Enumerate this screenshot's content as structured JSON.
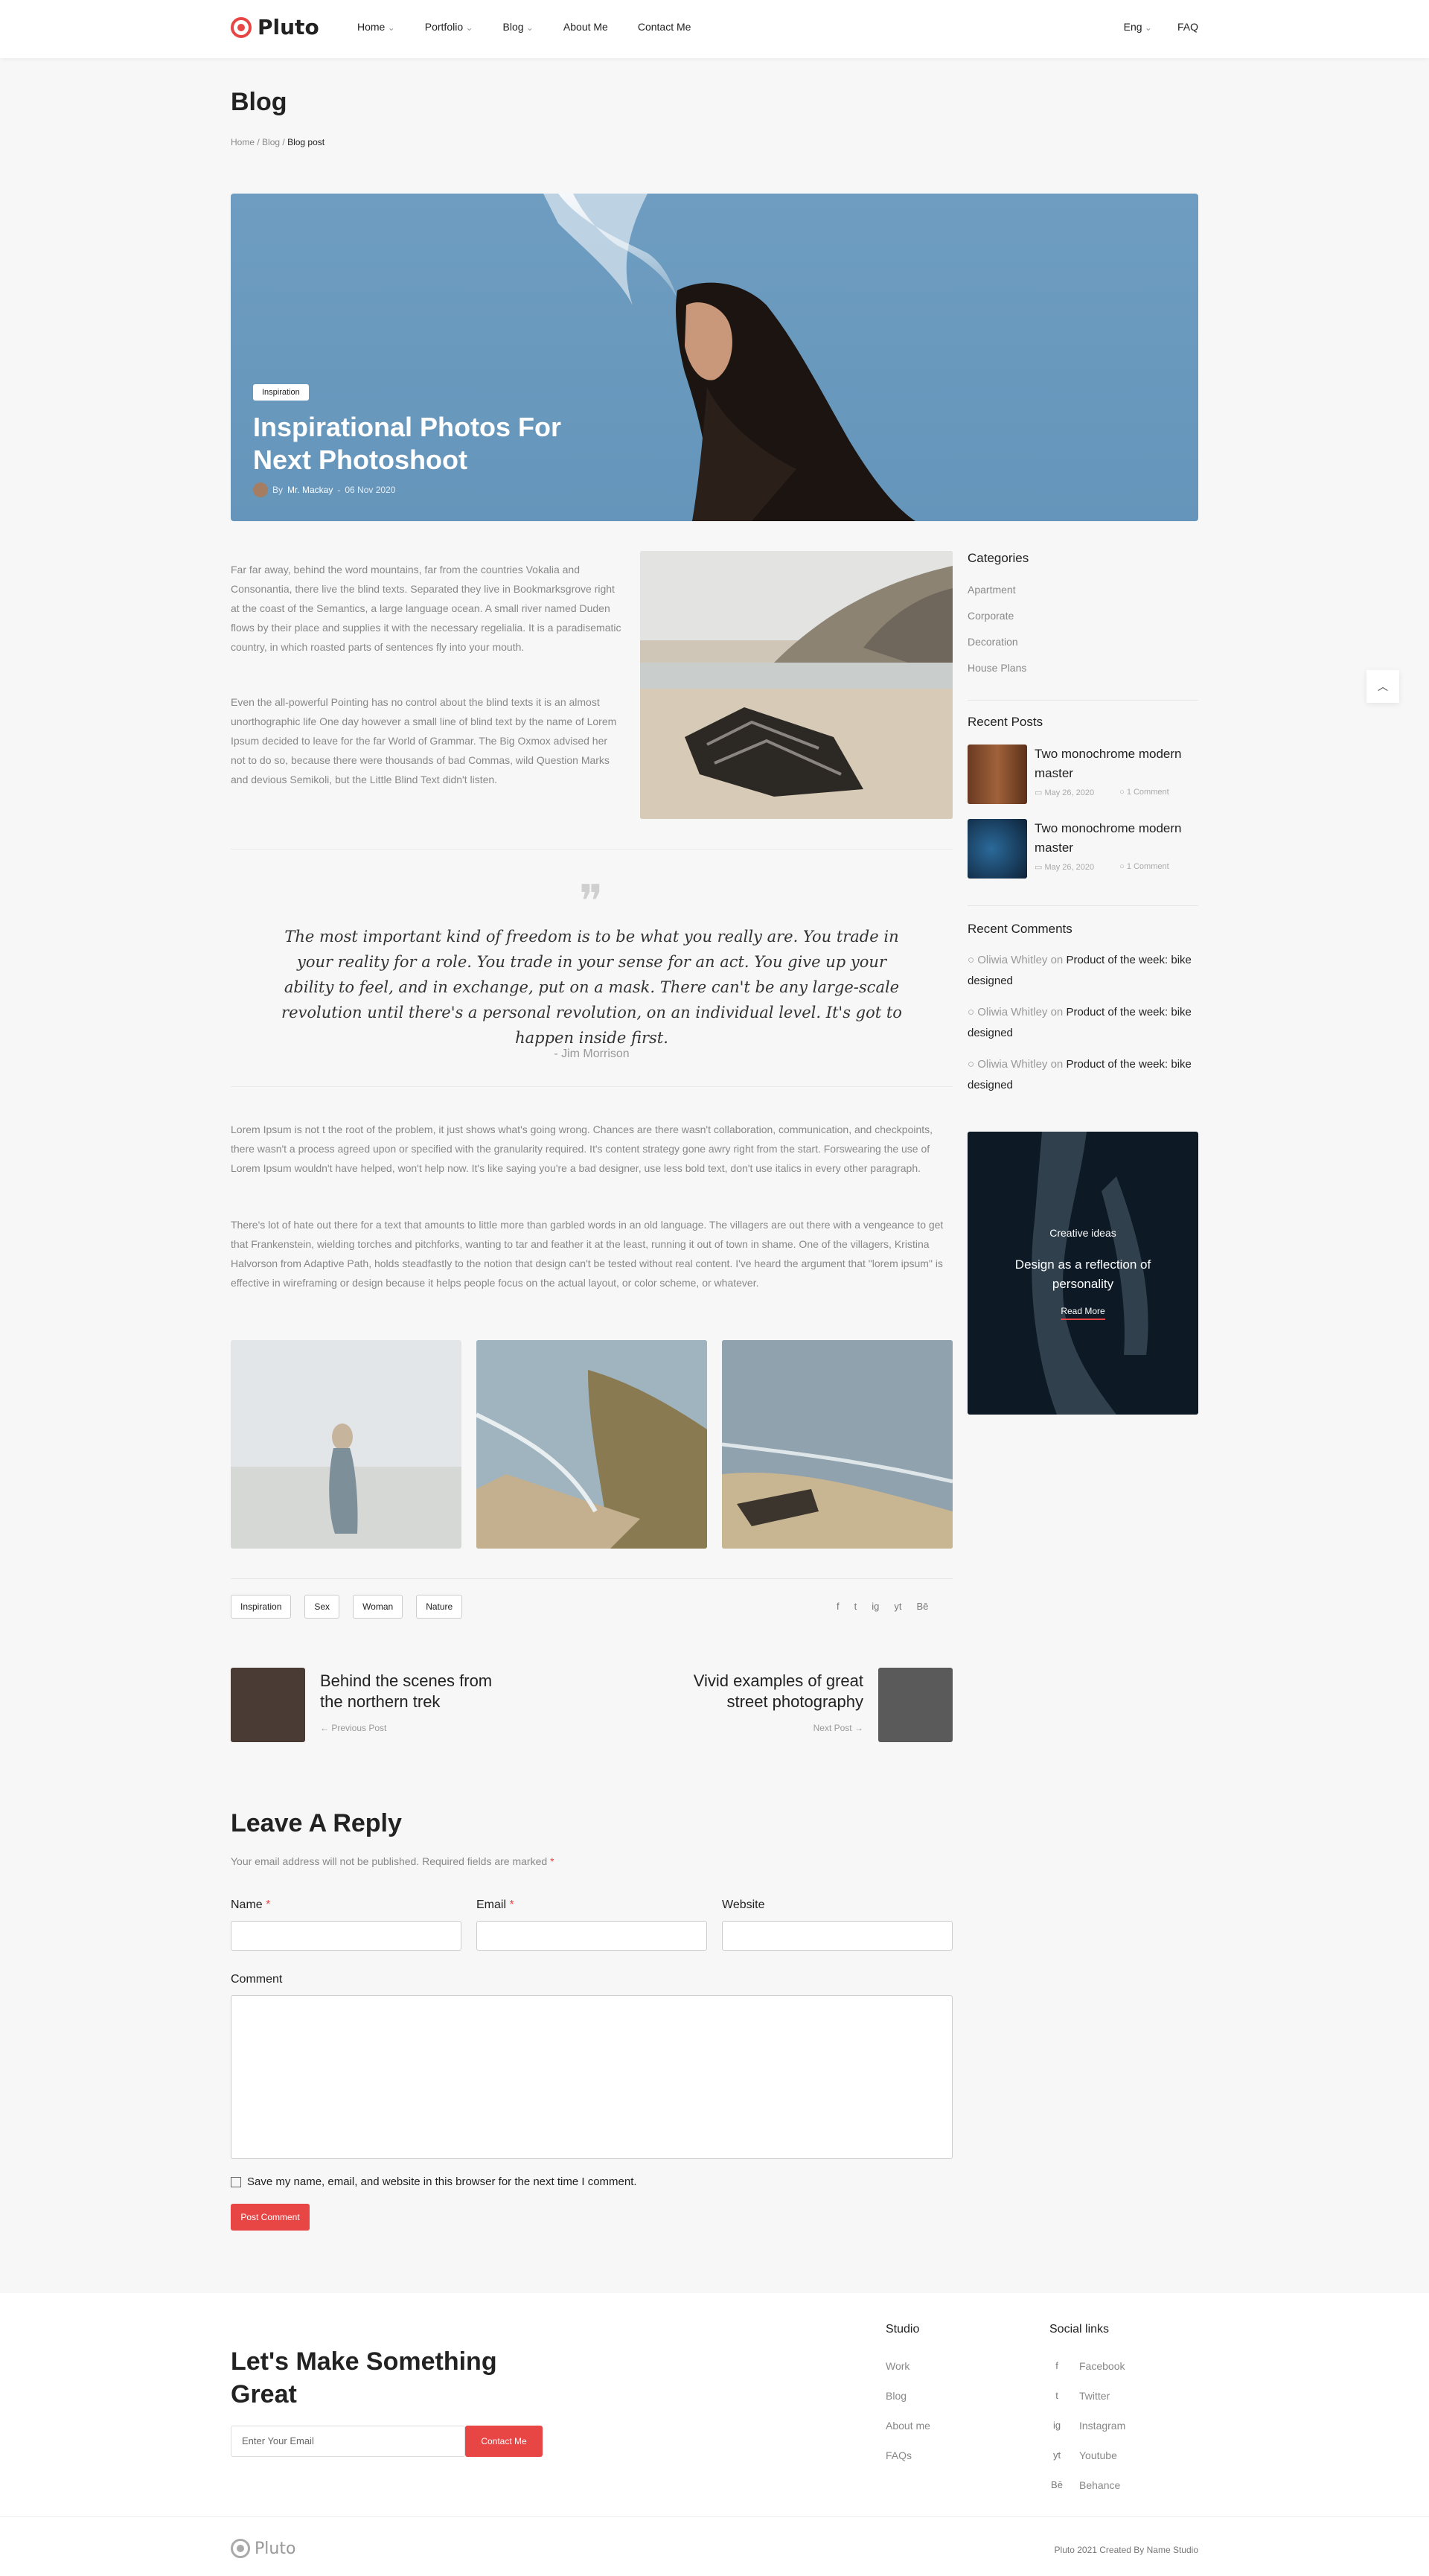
{
  "brand": {
    "name": "Pluto",
    "accent": "#e84545"
  },
  "nav": {
    "items": [
      "Home",
      "Portfolio",
      "Blog",
      "About Me",
      "Contact Me"
    ],
    "lang": "Eng",
    "faq": "FAQ"
  },
  "page": {
    "title": "Blog",
    "crumb_home": "Home",
    "crumb_blog": "Blog",
    "crumb_current": "Blog post"
  },
  "hero": {
    "tag": "Inspiration",
    "title": "Inspirational Photos For Next Photoshoot",
    "by": "By",
    "author": "Mr. Mackay",
    "date": "06 Nov 2020"
  },
  "article": {
    "p1": "Far far away, behind the word mountains, far from the countries Vokalia and Consonantia, there live the blind texts. Separated they live in Bookmarksgrove right at the coast of the Semantics, a large language ocean. A small river named Duden flows by their place and supplies it with the necessary regelialia. It is a paradisematic country, in which roasted parts of sentences fly into your mouth.",
    "p2": "Even the all-powerful Pointing has no control about the blind texts it is an almost unorthographic life One day however a small line of blind text by the name of Lorem Ipsum decided to leave for the far World of Grammar. The Big Oxmox advised her not to do so, because there were thousands of bad Commas, wild Question Marks and devious Semikoli, but the Little Blind Text didn't listen.",
    "quote": "The most important kind of freedom is to be what you really are. You trade in your reality for a role. You trade in your sense for an act. You give up your ability to feel, and in exchange, put on a mask. There can't be any large-scale revolution until there's a personal revolution, on an individual level. It's got to happen inside first.",
    "quote_author": "- Jim Morrison",
    "p3": "Lorem Ipsum is not t the root of the problem, it just shows what's going wrong. Chances are there wasn't collaboration, communication, and checkpoints, there wasn't a process agreed upon or specified with the granularity required. It's content strategy gone awry right from the start. Forswearing the use of Lorem Ipsum wouldn't have helped, won't help now. It's like saying you're a bad designer, use less bold text, don't use italics in every other paragraph.",
    "p4": "There's lot of hate out there for a text that amounts to little more than garbled words in an old language. The villagers are out there with a vengeance to get that Frankenstein, wielding torches and pitchforks, wanting to tar and feather it at the least, running it out of town in shame. One of the villagers, Kristina Halvorson from Adaptive Path, holds steadfastly to the notion that design can't be tested without real content. I've heard the argument that \"lorem ipsum\" is effective in wireframing or design because it helps people focus on the actual layout, or color scheme, or whatever.",
    "tags": [
      "Inspiration",
      "Sex",
      "Woman",
      "Nature"
    ],
    "social": [
      "f",
      "t",
      "ig",
      "yt",
      "Bē"
    ]
  },
  "post_nav": {
    "prev_title": "Behind the scenes from the northern trek",
    "prev_label": "Previous Post",
    "next_title": "Vivid examples of great street photography",
    "next_label": "Next Post"
  },
  "reply": {
    "title": "Leave A Reply",
    "note": "Your email address will not be published. Required fields are marked",
    "star": "*",
    "name": "Name",
    "email": "Email",
    "website": "Website",
    "comment": "Comment",
    "save": "Save my name, email, and website in this browser for the next time I comment.",
    "submit": "Post Comment"
  },
  "sidebar": {
    "categories_title": "Categories",
    "categories": [
      "Apartment",
      "Corporate",
      "Decoration",
      "House Plans"
    ],
    "recent_title": "Recent Posts",
    "recent": [
      {
        "title": "Two monochrome modern master",
        "date": "May 26, 2020",
        "comments": "1 Comment"
      },
      {
        "title": "Two monochrome modern master",
        "date": "May 26, 2020",
        "comments": "1 Comment"
      }
    ],
    "comments_title": "Recent Comments",
    "comments": [
      {
        "user": "Oliwia Whitley",
        "on": "on",
        "post": "Product of the week: bike designed"
      },
      {
        "user": "Oliwia Whitley",
        "on": "on",
        "post": "Product of the week: bike designed"
      },
      {
        "user": "Oliwia Whitley",
        "on": "on",
        "post": "Product of the week: bike designed"
      }
    ],
    "banner": {
      "kicker": "Creative ideas",
      "title": "Design as a reflection of personality",
      "link": "Read More"
    }
  },
  "footer": {
    "headline": "Let's Make Something Great",
    "email_placeholder": "Enter Your Email",
    "cta": "Contact Me",
    "studio_title": "Studio",
    "studio": [
      "Work",
      "Blog",
      "About me",
      "FAQs"
    ],
    "social_title": "Social links",
    "social": [
      "Facebook",
      "Twitter",
      "Instagram",
      "Youtube",
      "Behance"
    ],
    "social_icons": [
      "f",
      "t",
      "ig",
      "yt",
      "Bē"
    ],
    "logo": "Pluto",
    "copyright": "Pluto 2021 Created By Name Studio"
  }
}
